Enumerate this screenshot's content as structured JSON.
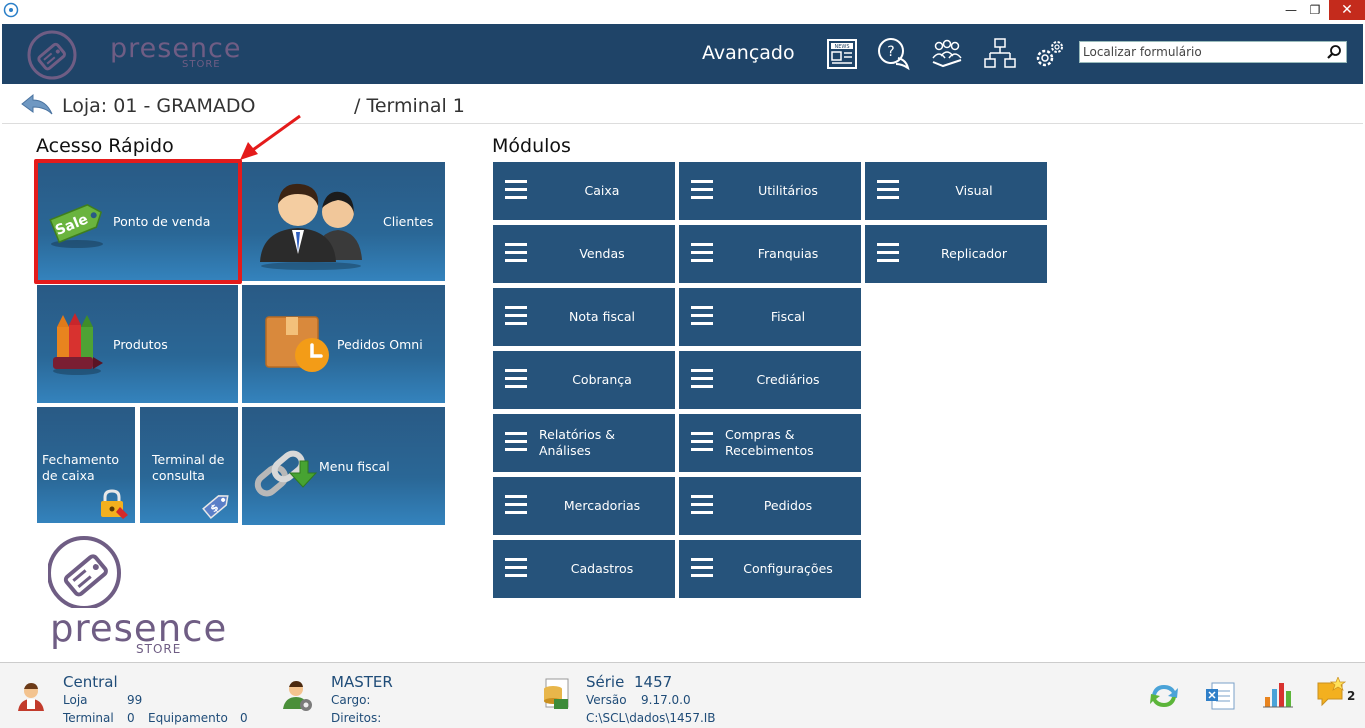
{
  "header": {
    "brand": "presence",
    "brand_sub": "STORE",
    "advanced_label": "Avançado",
    "search_placeholder": "Localizar formulário"
  },
  "breadcrumb": {
    "store": "Loja: 01 - GRAMADO",
    "terminal": "/ Terminal 1"
  },
  "quick_access": {
    "title": "Acesso Rápido",
    "tiles": {
      "pos": "Ponto de venda",
      "sale_tag": "Sale",
      "clients": "Clientes",
      "products": "Produtos",
      "omni_orders": "Pedidos Omni",
      "cash_close": "Fechamento de caixa",
      "consult_terminal": "Terminal de consulta",
      "fiscal_menu": "Menu fiscal"
    }
  },
  "modules": {
    "title": "Módulos",
    "items": [
      "Caixa",
      "Utilitários",
      "Visual",
      "Vendas",
      "Franquias",
      "Replicador",
      "Nota fiscal",
      "Fiscal",
      "Cobrança",
      "Crediários",
      "Relatórios & Análises",
      "Compras & Recebimentos",
      "Mercadorias",
      "Pedidos",
      "Cadastros",
      "Configurações"
    ]
  },
  "footer": {
    "central": "Central",
    "loja_label": "Loja",
    "loja_value": "99",
    "terminal_label": "Terminal",
    "terminal_value": "0",
    "equip_label": "Equipamento",
    "equip_value": "0",
    "user": "MASTER",
    "cargo_label": "Cargo:",
    "direitos_label": "Direitos:",
    "serie_label": "Série",
    "serie_value": "1457",
    "versao_label": "Versão",
    "versao_value": "9.17.0.0",
    "path": "C:\\SCL\\dados\\1457.IB",
    "notif_count": "2"
  },
  "colors": {
    "header_bg": "#1f4468",
    "tile_bg": "#26537b",
    "highlight": "#e41b1b",
    "brand_purple": "#6f5d84"
  }
}
